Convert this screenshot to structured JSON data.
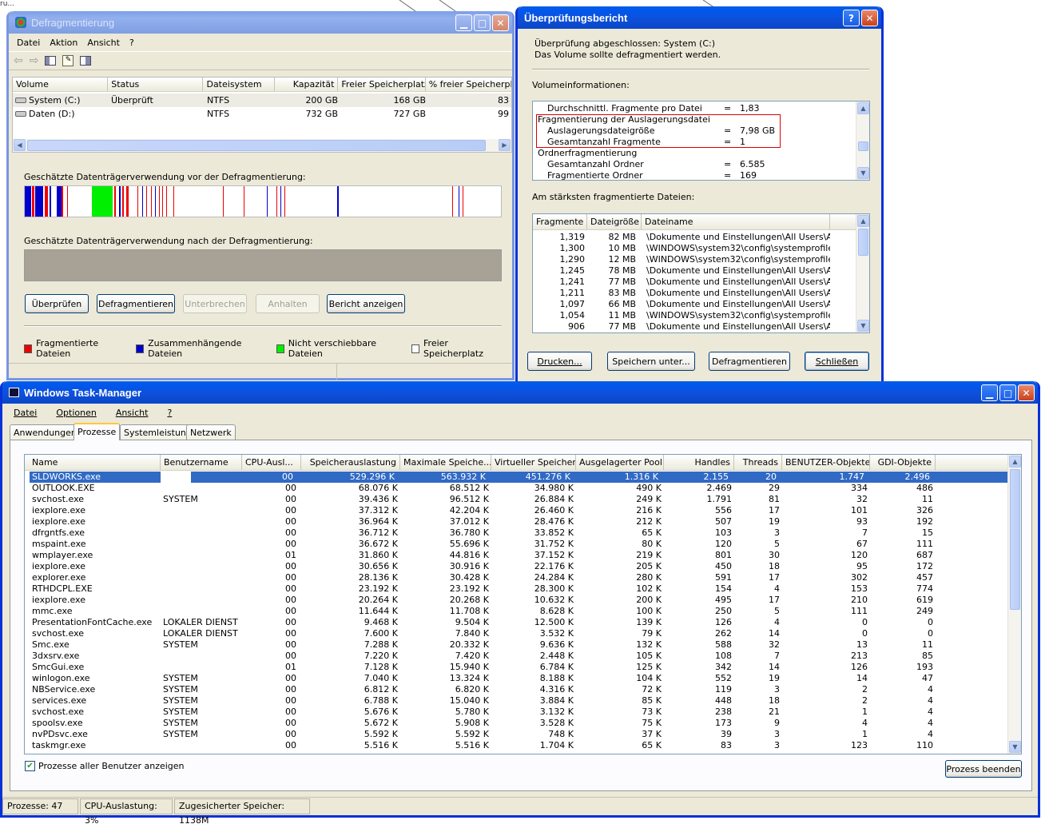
{
  "background": {
    "partial_text": "ru..."
  },
  "defrag": {
    "title": "Defragmentierung",
    "menu": [
      "Datei",
      "Aktion",
      "Ansicht",
      "?"
    ],
    "columns": [
      "Volume",
      "Status",
      "Dateisystem",
      "Kapazität",
      "Freier Speicherplatz",
      "% freier Speicherpla"
    ],
    "volumes": [
      {
        "name": "System (C:)",
        "status": "Überprüft",
        "fs": "NTFS",
        "cap": "200 GB",
        "free": "168 GB",
        "pct": "83"
      },
      {
        "name": "Daten (D:)",
        "status": "",
        "fs": "NTFS",
        "cap": "732 GB",
        "free": "727 GB",
        "pct": "99"
      }
    ],
    "before_label": "Geschätzte Datenträgerverwendung vor der Defragmentierung:",
    "after_label": "Geschätzte Datenträgerverwendung nach der Defragmentierung:",
    "buttons": [
      "Überprüfen",
      "Defragmentieren",
      "Unterbrechen",
      "Anhalten",
      "Bericht anzeigen"
    ],
    "legend": [
      "Fragmentierte Dateien",
      "Zusammenhängende Dateien",
      "Nicht verschiebbare Dateien",
      "Freier Speicherplatz"
    ],
    "colors": {
      "fragmented": "#ee0000",
      "contiguous": "#0000cc",
      "unmovable": "#00ee00",
      "free": "#ffffff"
    }
  },
  "report": {
    "title": "Überprüfungsbericht",
    "summary1": "Überprüfung abgeschlossen: System (C:)",
    "summary2": "Das Volume sollte defragmentiert werden.",
    "vol_info_label": "Volumeinformationen:",
    "vol_info": [
      {
        "label": "Durchschnittl. Fragmente pro Datei",
        "eq": "=",
        "value": "1,83",
        "indent": true
      },
      {
        "label": "Fragmentierung der Auslagerungsdatei",
        "eq": "",
        "value": "",
        "indent": false
      },
      {
        "label": "Auslagerungsdateigröße",
        "eq": "=",
        "value": "7,98 GB",
        "indent": true
      },
      {
        "label": "Gesamtanzahl Fragmente",
        "eq": "=",
        "value": "1",
        "indent": true
      },
      {
        "label": "Ordnerfragmentierung",
        "eq": "",
        "value": "",
        "indent": false
      },
      {
        "label": "Gesamtanzahl Ordner",
        "eq": "=",
        "value": "6.585",
        "indent": true
      },
      {
        "label": "Fragmentierte Ordner",
        "eq": "=",
        "value": "169",
        "indent": true
      }
    ],
    "frag_files_label": "Am stärksten fragmentierte Dateien:",
    "frag_columns": [
      "Fragmente",
      "Dateigröße",
      "Dateiname"
    ],
    "frag_files": [
      [
        "1,319",
        "82 MB",
        "\\Dokumente und Einstellungen\\All Users\\An..."
      ],
      [
        "1,300",
        "10 MB",
        "\\WINDOWS\\system32\\config\\systemprofile\\..."
      ],
      [
        "1,290",
        "12 MB",
        "\\WINDOWS\\system32\\config\\systemprofile\\..."
      ],
      [
        "1,245",
        "78 MB",
        "\\Dokumente und Einstellungen\\All Users\\An..."
      ],
      [
        "1,241",
        "77 MB",
        "\\Dokumente und Einstellungen\\All Users\\An..."
      ],
      [
        "1,211",
        "83 MB",
        "\\Dokumente und Einstellungen\\All Users\\An..."
      ],
      [
        "1,097",
        "66 MB",
        "\\Dokumente und Einstellungen\\All Users\\An..."
      ],
      [
        "1,054",
        "11 MB",
        "\\WINDOWS\\system32\\config\\systemprofile\\..."
      ],
      [
        "906",
        "77 MB",
        "\\Dokumente und Einstellungen\\All Users\\An..."
      ]
    ],
    "buttons": {
      "print": "Drucken...",
      "save": "Speichern unter...",
      "defrag": "Defragmentieren",
      "close": "Schließen"
    }
  },
  "taskmgr": {
    "title": "Windows Task-Manager",
    "menu": [
      "Datei",
      "Optionen",
      "Ansicht",
      "?"
    ],
    "tabs": [
      "Anwendungen",
      "Prozesse",
      "Systemleistung",
      "Netzwerk"
    ],
    "columns": [
      "Name",
      "Benutzername",
      "CPU-Ausl...",
      "Speicherauslastung",
      "Maximale Speiche...",
      "Virtueller Speicher",
      "Ausgelagerter Pool",
      "Handles",
      "Threads",
      "BENUTZER-Objekte",
      "GDI-Objekte"
    ],
    "rows": [
      [
        "SLDWORKS.exe",
        "",
        "00",
        "529.296 K",
        "563.932 K",
        "451.276 K",
        "1.316 K",
        "2.155",
        "20",
        "1.747",
        "2.496"
      ],
      [
        "OUTLOOK.EXE",
        "",
        "00",
        "68.076 K",
        "68.512 K",
        "34.980 K",
        "490 K",
        "2.469",
        "29",
        "334",
        "486"
      ],
      [
        "svchost.exe",
        "SYSTEM",
        "00",
        "39.436 K",
        "96.512 K",
        "26.884 K",
        "249 K",
        "1.791",
        "81",
        "32",
        "11"
      ],
      [
        "iexplore.exe",
        "",
        "00",
        "37.312 K",
        "42.204 K",
        "26.460 K",
        "216 K",
        "556",
        "17",
        "101",
        "326"
      ],
      [
        "iexplore.exe",
        "",
        "00",
        "36.964 K",
        "37.012 K",
        "28.476 K",
        "212 K",
        "507",
        "19",
        "93",
        "192"
      ],
      [
        "dfrgntfs.exe",
        "",
        "00",
        "36.712 K",
        "36.780 K",
        "33.852 K",
        "65 K",
        "103",
        "3",
        "7",
        "15"
      ],
      [
        "mspaint.exe",
        "",
        "00",
        "36.672 K",
        "55.696 K",
        "31.752 K",
        "80 K",
        "120",
        "5",
        "67",
        "111"
      ],
      [
        "wmplayer.exe",
        "",
        "01",
        "31.860 K",
        "44.816 K",
        "37.152 K",
        "219 K",
        "801",
        "30",
        "120",
        "687"
      ],
      [
        "iexplore.exe",
        "",
        "00",
        "30.656 K",
        "30.916 K",
        "22.176 K",
        "205 K",
        "450",
        "18",
        "95",
        "172"
      ],
      [
        "explorer.exe",
        "",
        "00",
        "28.136 K",
        "30.428 K",
        "24.284 K",
        "280 K",
        "591",
        "17",
        "302",
        "457"
      ],
      [
        "RTHDCPL.EXE",
        "",
        "00",
        "23.192 K",
        "23.192 K",
        "28.300 K",
        "102 K",
        "154",
        "4",
        "153",
        "774"
      ],
      [
        "iexplore.exe",
        "",
        "00",
        "20.264 K",
        "20.268 K",
        "10.632 K",
        "200 K",
        "495",
        "17",
        "210",
        "619"
      ],
      [
        "mmc.exe",
        "",
        "00",
        "11.644 K",
        "11.708 K",
        "8.628 K",
        "100 K",
        "250",
        "5",
        "111",
        "249"
      ],
      [
        "PresentationFontCache.exe",
        "LOKALER DIENST",
        "00",
        "9.468 K",
        "9.504 K",
        "12.500 K",
        "139 K",
        "126",
        "4",
        "0",
        "0"
      ],
      [
        "svchost.exe",
        "LOKALER DIENST",
        "00",
        "7.600 K",
        "7.840 K",
        "3.532 K",
        "79 K",
        "262",
        "14",
        "0",
        "0"
      ],
      [
        "Smc.exe",
        "SYSTEM",
        "00",
        "7.288 K",
        "20.332 K",
        "9.636 K",
        "132 K",
        "588",
        "32",
        "13",
        "11"
      ],
      [
        "3dxsrv.exe",
        "",
        "00",
        "7.220 K",
        "7.420 K",
        "2.448 K",
        "105 K",
        "108",
        "7",
        "213",
        "85"
      ],
      [
        "SmcGui.exe",
        "",
        "01",
        "7.128 K",
        "15.940 K",
        "6.784 K",
        "125 K",
        "342",
        "14",
        "126",
        "193"
      ],
      [
        "winlogon.exe",
        "SYSTEM",
        "00",
        "7.040 K",
        "13.324 K",
        "8.188 K",
        "104 K",
        "552",
        "19",
        "14",
        "47"
      ],
      [
        "NBService.exe",
        "SYSTEM",
        "00",
        "6.812 K",
        "6.820 K",
        "4.316 K",
        "72 K",
        "119",
        "3",
        "2",
        "4"
      ],
      [
        "services.exe",
        "SYSTEM",
        "00",
        "6.788 K",
        "15.040 K",
        "3.884 K",
        "85 K",
        "448",
        "18",
        "2",
        "4"
      ],
      [
        "svchost.exe",
        "SYSTEM",
        "00",
        "5.676 K",
        "5.780 K",
        "3.132 K",
        "73 K",
        "238",
        "21",
        "1",
        "4"
      ],
      [
        "spoolsv.exe",
        "SYSTEM",
        "00",
        "5.672 K",
        "5.908 K",
        "3.528 K",
        "75 K",
        "173",
        "9",
        "4",
        "4"
      ],
      [
        "nvPDsvc.exe",
        "SYSTEM",
        "00",
        "5.592 K",
        "5.592 K",
        "748 K",
        "37 K",
        "39",
        "3",
        "1",
        "4"
      ],
      [
        "taskmgr.exe",
        "",
        "00",
        "5.516 K",
        "5.516 K",
        "1.704 K",
        "65 K",
        "83",
        "3",
        "123",
        "110"
      ]
    ],
    "show_all_label": "Prozesse aller Benutzer anzeigen",
    "end_process": "Prozess beenden",
    "status": [
      "Prozesse: 47",
      "CPU-Auslastung: 3%",
      "Zugesicherter Speicher: 1138M"
    ]
  }
}
